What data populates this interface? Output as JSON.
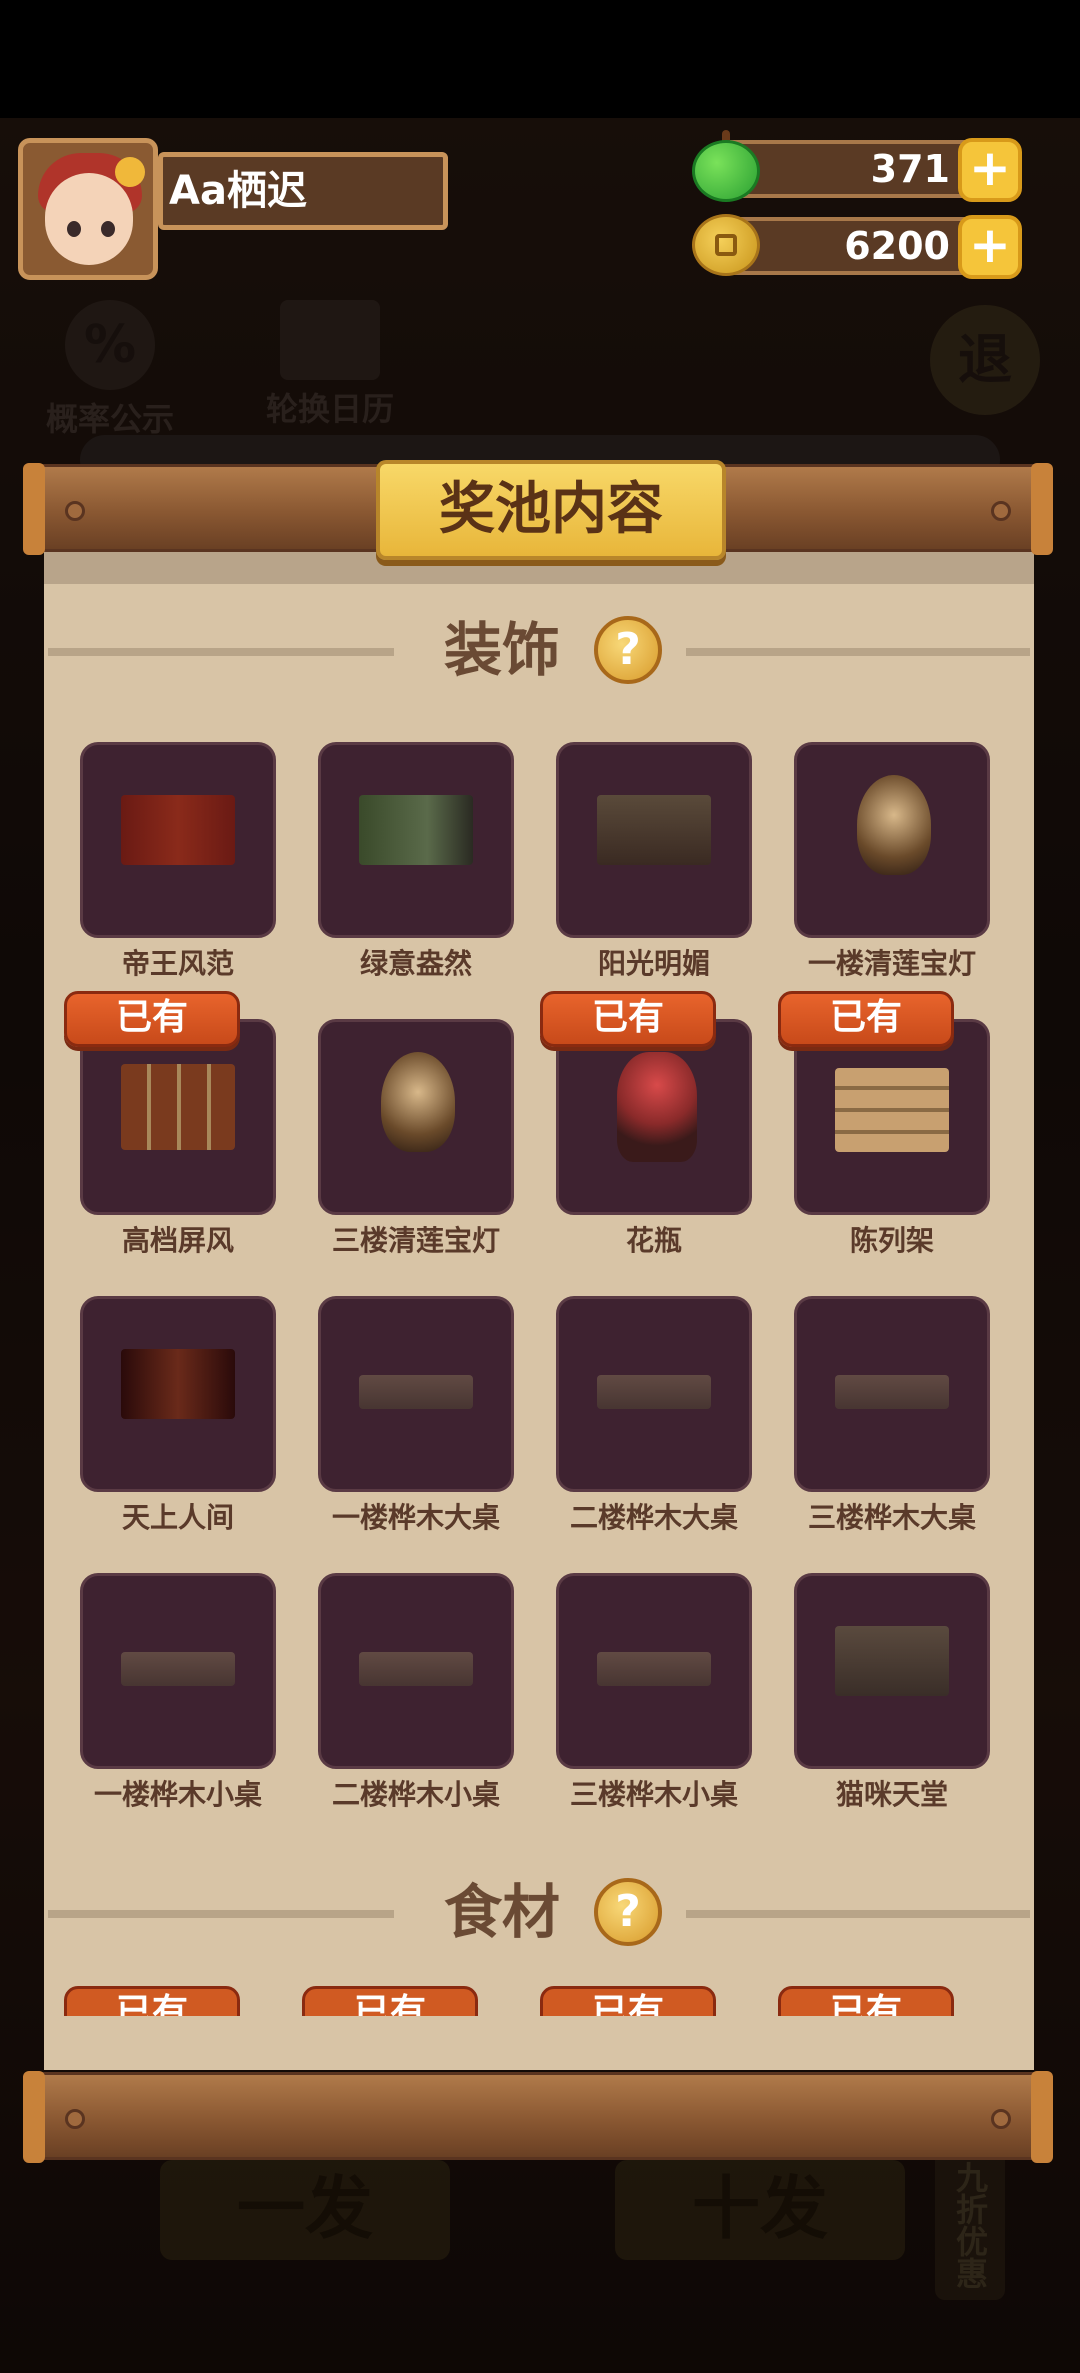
{
  "player": {
    "name": "Aa栖迟"
  },
  "resources": {
    "apples": "371",
    "coins": "6200",
    "plus_label": "+"
  },
  "background": {
    "probability_label": "概率公示",
    "probability_glyph": "%",
    "calendar_label": "轮换日历",
    "exit_label": "退",
    "draw_one": "一发",
    "draw_ten": "十发",
    "discount": "九折优惠"
  },
  "panel": {
    "title": "奖池内容",
    "help_glyph": "?",
    "sections": [
      {
        "title": "装饰",
        "items": [
          {
            "name": "帝王风范",
            "owned": false,
            "icon": "red-curtain-room"
          },
          {
            "name": "绿意盎然",
            "owned": false,
            "icon": "green-room"
          },
          {
            "name": "阳光明媚",
            "owned": false,
            "icon": "shopfront"
          },
          {
            "name": "一楼清莲宝灯",
            "owned": false,
            "icon": "lotus-lamp"
          },
          {
            "name": "高档屏风",
            "owned": true,
            "icon": "folding-screen"
          },
          {
            "name": "三楼清莲宝灯",
            "owned": false,
            "icon": "lotus-lamp"
          },
          {
            "name": "花瓶",
            "owned": true,
            "icon": "flower-vase"
          },
          {
            "name": "陈列架",
            "owned": true,
            "icon": "display-shelf"
          },
          {
            "name": "天上人间",
            "owned": false,
            "icon": "dark-red-room"
          },
          {
            "name": "一楼桦木大桌",
            "owned": false,
            "icon": "birch-table"
          },
          {
            "name": "二楼桦木大桌",
            "owned": false,
            "icon": "birch-table"
          },
          {
            "name": "三楼桦木大桌",
            "owned": false,
            "icon": "birch-table"
          },
          {
            "name": "一楼桦木小桌",
            "owned": false,
            "icon": "birch-table"
          },
          {
            "name": "二楼桦木小桌",
            "owned": false,
            "icon": "birch-table"
          },
          {
            "name": "三楼桦木小桌",
            "owned": false,
            "icon": "birch-table"
          },
          {
            "name": "猫咪天堂",
            "owned": false,
            "icon": "cat-room"
          }
        ]
      },
      {
        "title": "食材",
        "items": []
      }
    ],
    "owned_label": "已有"
  }
}
